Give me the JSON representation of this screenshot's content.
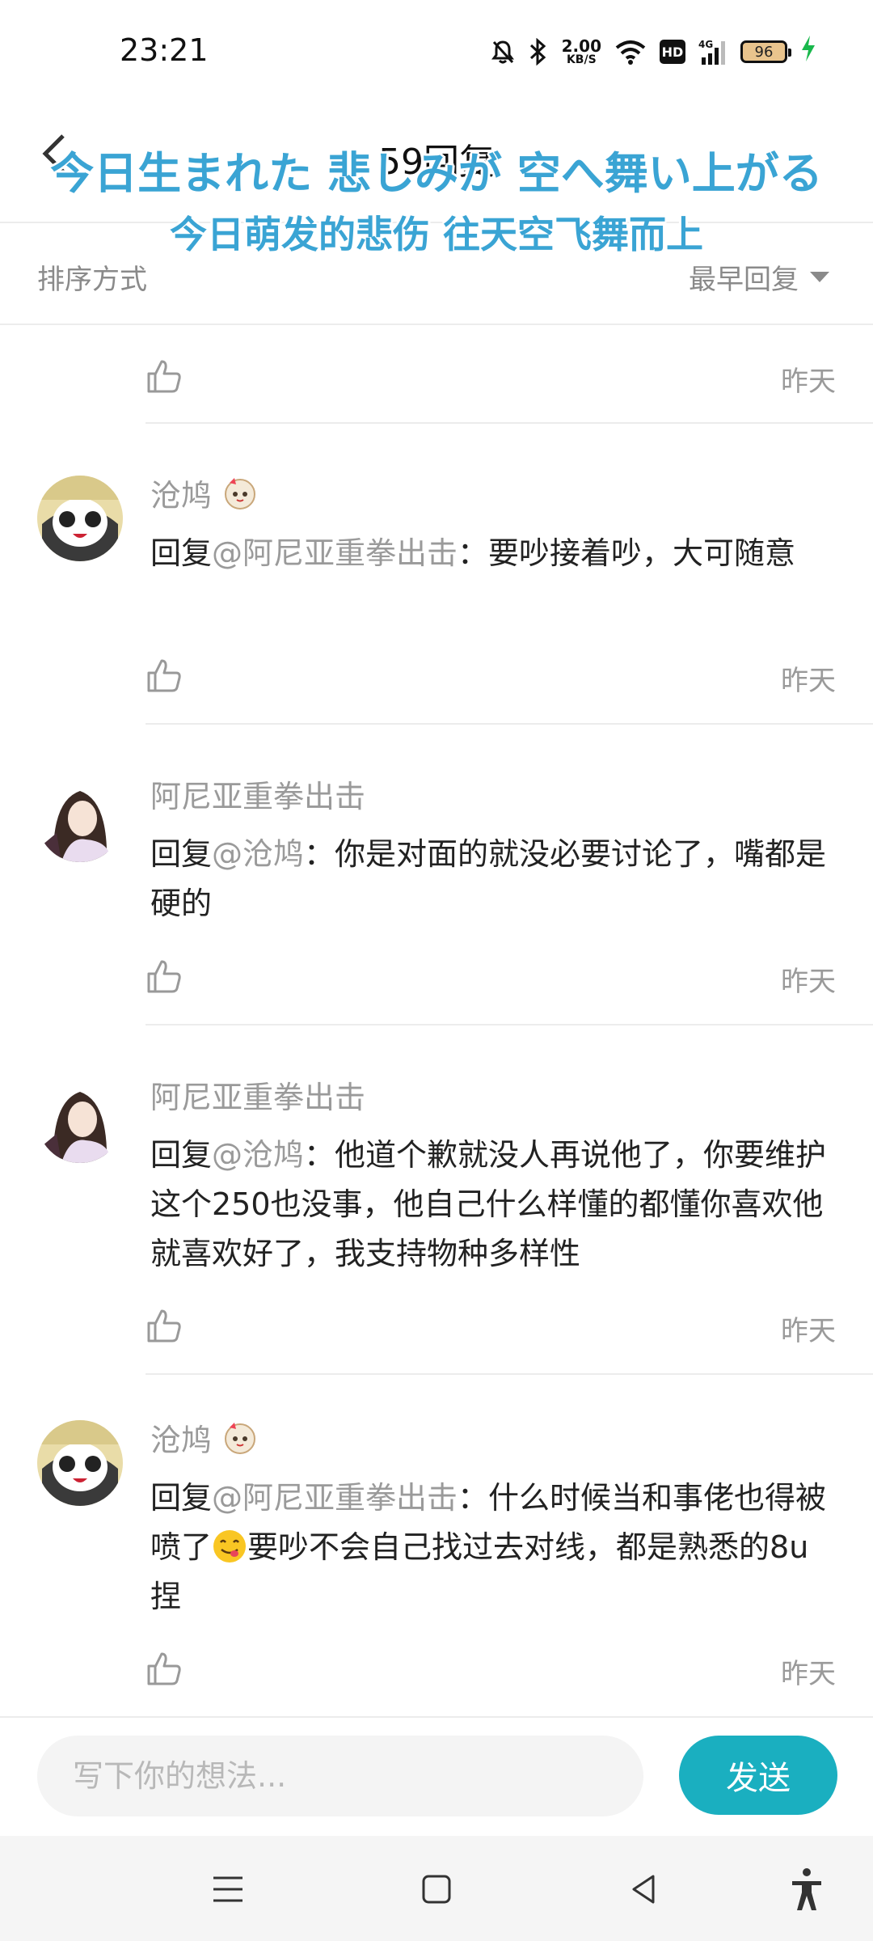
{
  "status_bar": {
    "time": "23:21",
    "net_speed_value": "2.00",
    "net_speed_unit": "KB/S",
    "hd_label": "HD",
    "network_label": "4G",
    "battery": "96"
  },
  "header": {
    "title": "59回复",
    "lyric_line1": "今日生まれた 悲しみが 空へ舞い上がる",
    "lyric_line2": "今日萌发的悲伤 往天空飞舞而上"
  },
  "sort": {
    "label": "排序方式",
    "value": "最早回复"
  },
  "comments": [
    {
      "date": "昨天"
    },
    {
      "username": "沧鸠",
      "reply_prefix": "回复",
      "mention": "@阿尼亚重拳出击",
      "text": "：要吵接着吵，大可随意",
      "date": "昨天"
    },
    {
      "username": "阿尼亚重拳出击",
      "reply_prefix": "回复",
      "mention": "@沧鸠",
      "text": "：你是对面的就没必要讨论了，嘴都是硬的",
      "date": "昨天"
    },
    {
      "username": "阿尼亚重拳出击",
      "reply_prefix": "回复",
      "mention": "@沧鸠",
      "text": "：他道个歉就没人再说他了，你要维护这个250也没事，他自己什么样懂的都懂你喜欢他就喜欢好了，我支持物种多样性",
      "date": "昨天"
    },
    {
      "username": "沧鸠",
      "reply_prefix": "回复",
      "mention": "@阿尼亚重拳出击",
      "text_before_emoji": "：什么时候当和事佬也得被喷了",
      "text_after_emoji": "要吵不会自己找过去对线，都是熟悉的8u捏",
      "date": "昨天"
    }
  ],
  "input": {
    "placeholder": "写下你的想法...",
    "value": ""
  },
  "send_label": "发送",
  "colors": {
    "accent": "#1aafc0",
    "lyric": "#3aa4d4",
    "secondary_text": "#9a9a9a"
  }
}
